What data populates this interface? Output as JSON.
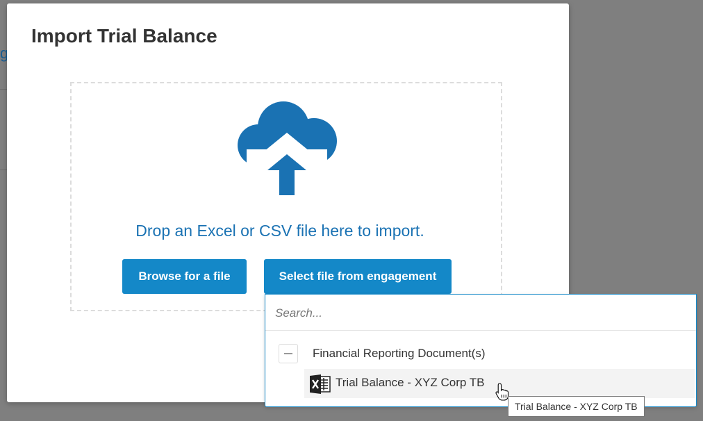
{
  "modal": {
    "title": "Import Trial Balance",
    "drop_text": "Drop an Excel or CSV file here to import.",
    "browse_label": "Browse for a file",
    "select_label": "Select file from engagement"
  },
  "dropdown": {
    "search_placeholder": "Search...",
    "group": {
      "label": "Financial Reporting Document(s)",
      "expanded": true,
      "files": [
        {
          "name": "Trial Balance - XYZ Corp TB",
          "icon": "excel-file-icon"
        }
      ]
    }
  },
  "tooltip": {
    "text": "Trial Balance - XYZ Corp TB"
  },
  "colors": {
    "accent": "#1488c8",
    "link_text": "#1a72b3",
    "overlay": "#7f7f7f"
  },
  "icons": {
    "upload": "cloud-upload-icon",
    "collapse": "minus-icon",
    "cursor": "hand-pointer-icon"
  }
}
